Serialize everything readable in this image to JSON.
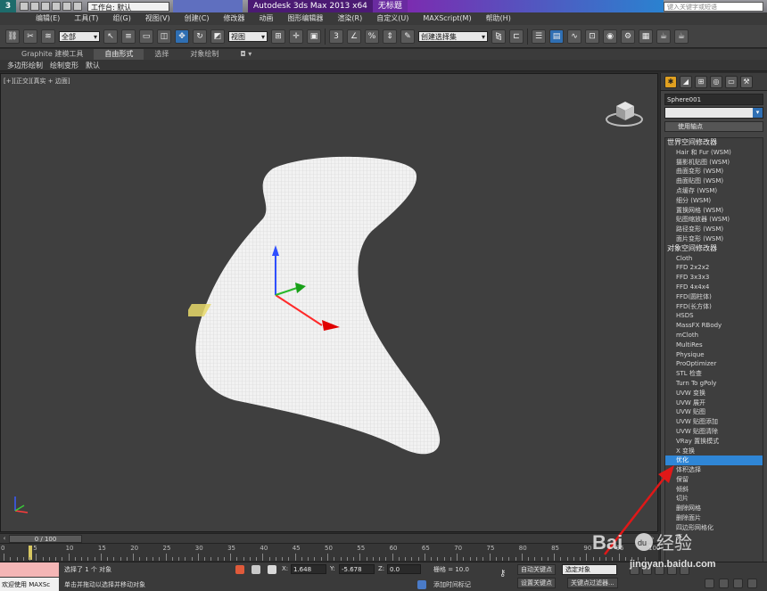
{
  "titlebar": {
    "workspace": "工作台: 默认",
    "app_title": "Autodesk 3ds Max  2013 x64",
    "doc_title": "无标题",
    "search_placeholder": "键入关键字或短语"
  },
  "menu": [
    "编辑(E)",
    "工具(T)",
    "组(G)",
    "视图(V)",
    "创建(C)",
    "修改器",
    "动画",
    "图形编辑器",
    "渲染(R)",
    "自定义(U)",
    "MAXScript(M)",
    "帮助(H)"
  ],
  "toolbar": {
    "filter_value": "全部",
    "refcoord_value": "视图",
    "named_sel_value": "创建选择集",
    "snap_label": "3"
  },
  "ribbon": {
    "tabs": [
      "Graphite 建模工具",
      "自由形式",
      "选择",
      "对象绘制"
    ],
    "sub": [
      "多边形绘制",
      "绘制变形",
      "默认"
    ]
  },
  "viewport": {
    "label": "[+][正交][真实 + 边面]"
  },
  "command_panel": {
    "object_name": "Sphere001",
    "pivot_button": "使用轴点",
    "groups": [
      {
        "header": "世界空间修改器",
        "items": [
          "Hair 和 Fur (WSM)",
          "摄影机贴图 (WSM)",
          "曲面变形 (WSM)",
          "曲面贴图 (WSM)",
          "点缓存 (WSM)",
          "细分 (WSM)",
          "置换网格 (WSM)",
          "贴图缩放器 (WSM)",
          "路径变形 (WSM)",
          "面片变形 (WSM)"
        ]
      },
      {
        "header": "对象空间修改器",
        "items": [
          "Cloth",
          "FFD 2x2x2",
          "FFD 3x3x3",
          "FFD 4x4x4",
          "FFD(圆柱体)",
          "FFD(长方体)",
          "HSDS",
          "MassFX RBody",
          "mCloth",
          "MultiRes",
          "Physique",
          "ProOptimizer",
          "STL 检查",
          "Turn To gPoly",
          "UVW 变换",
          "UVW 展开",
          "UVW 贴图",
          "UVW 贴图添加",
          "UVW 贴图清除",
          "VRay 置换模式",
          "X 变换",
          "优化",
          "体积选择",
          "保留",
          "倾斜",
          "切片",
          "删除网格",
          "删除面片",
          "四边形网格化",
          "壳"
        ]
      }
    ],
    "selected_item": "优化"
  },
  "timeslider": {
    "frame_label": "0 / 100",
    "ticks": [
      "0",
      "5",
      "10",
      "15",
      "20",
      "25",
      "30",
      "35",
      "40",
      "45",
      "50",
      "55",
      "60",
      "65",
      "70",
      "75",
      "80",
      "85",
      "90",
      "95",
      "100"
    ]
  },
  "statusbar": {
    "welcome": "欢迎使用 MAXSc",
    "status_line1": "选择了 1 个 对象",
    "status_line2": "单击并拖动以选择并移动对象",
    "x_label": "X:",
    "x_value": "1.648",
    "y_label": "Y:",
    "y_value": "-5.678",
    "z_label": "Z:",
    "z_value": "0.0",
    "grid_label": "栅格 = 10.0",
    "add_time_tag": "添加时间标记",
    "auto_key": "自动关键点",
    "selected_obj": "选定对象",
    "set_key": "设置关键点",
    "key_filters": "关键点过滤器..."
  },
  "watermark": {
    "brand": "Baidu 经验",
    "url": "jingyan.baidu.com"
  }
}
